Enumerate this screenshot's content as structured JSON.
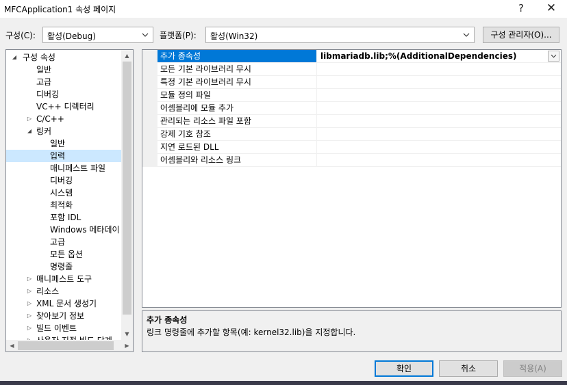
{
  "window": {
    "title": "MFCApplication1 속성 페이지",
    "help_glyph": "?",
    "close_glyph": "✕"
  },
  "config": {
    "config_label": "구성(C):",
    "config_value": "활성(Debug)",
    "platform_label": "플랫폼(P):",
    "platform_value": "활성(Win32)",
    "manager_button": "구성 관리자(O)..."
  },
  "tree": {
    "root": "구성 속성",
    "items": [
      {
        "label": "일반"
      },
      {
        "label": "고급"
      },
      {
        "label": "디버깅"
      },
      {
        "label": "VC++ 디렉터리"
      },
      {
        "label": "C/C++"
      },
      {
        "label": "링커"
      },
      {
        "label": "일반"
      },
      {
        "label": "입력"
      },
      {
        "label": "매니페스트 파일"
      },
      {
        "label": "디버깅"
      },
      {
        "label": "시스템"
      },
      {
        "label": "최적화"
      },
      {
        "label": "포함 IDL"
      },
      {
        "label": "Windows 메타데이"
      },
      {
        "label": "고급"
      },
      {
        "label": "모든 옵션"
      },
      {
        "label": "명령줄"
      },
      {
        "label": "매니페스트 도구"
      },
      {
        "label": "리소스"
      },
      {
        "label": "XML 문서 생성기"
      },
      {
        "label": "찾아보기 정보"
      },
      {
        "label": "빌드 이벤트"
      },
      {
        "label": "사용자 지정 빌드 단계"
      }
    ],
    "selected": "입력"
  },
  "grid": {
    "rows": [
      {
        "name": "추가 종속성",
        "value": "libmariadb.lib;%(AdditionalDependencies)"
      },
      {
        "name": "모든 기본 라이브러리 무시",
        "value": ""
      },
      {
        "name": "특정 기본 라이브러리 무시",
        "value": ""
      },
      {
        "name": "모듈 정의 파일",
        "value": ""
      },
      {
        "name": "어셈블리에 모듈 추가",
        "value": ""
      },
      {
        "name": "관리되는 리소스 파일 포함",
        "value": ""
      },
      {
        "name": "강제 기호 참조",
        "value": ""
      },
      {
        "name": "지연 로드된 DLL",
        "value": ""
      },
      {
        "name": "어셈블리와 리소스 링크",
        "value": ""
      }
    ]
  },
  "description": {
    "title": "추가 종속성",
    "text": "링크 명령줄에 추가할 항목(예: kernel32.lib)을 지정합니다."
  },
  "buttons": {
    "ok": "확인",
    "cancel": "취소",
    "apply": "적용(A)"
  },
  "colors": {
    "selection": "#0078d7",
    "tree_selection": "#cce8ff",
    "ok_border": "#0078d7"
  }
}
